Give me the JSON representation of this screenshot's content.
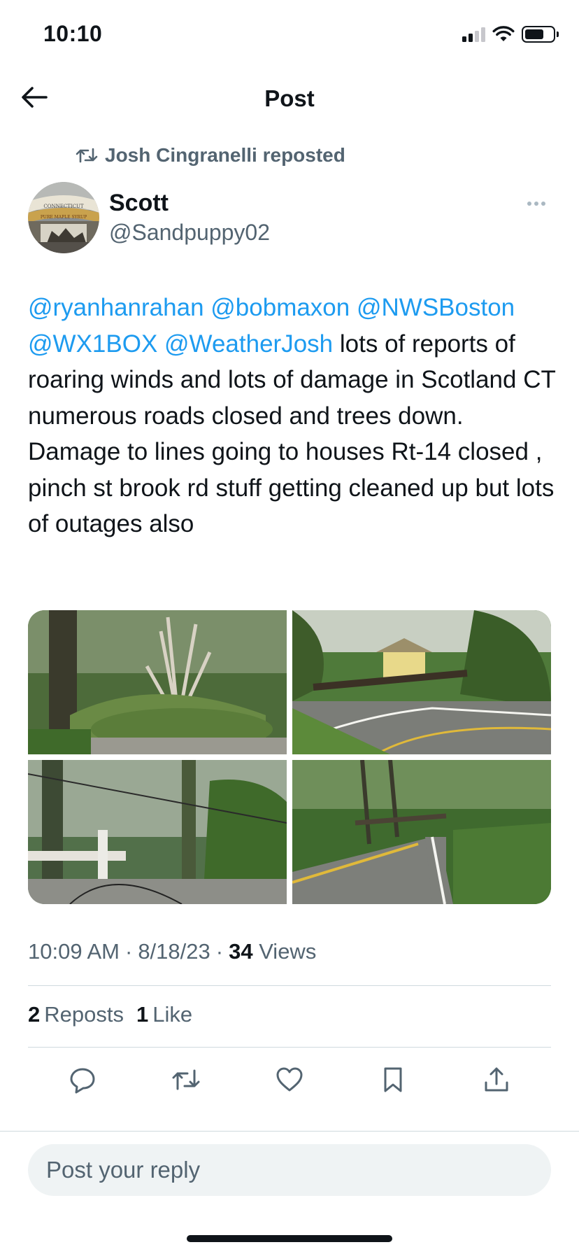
{
  "status_bar": {
    "time": "10:10"
  },
  "header": {
    "title": "Post"
  },
  "repost": {
    "text": "Josh Cingranelli reposted"
  },
  "author": {
    "name": "Scott",
    "handle": "@Sandpuppy02",
    "avatar_text_1": "CONNECTICUT",
    "avatar_text_2": "PURE MAPLE SYRUP"
  },
  "post": {
    "mentions": [
      "@ryanhanrahan",
      "@bobmaxon",
      "@NWSBoston",
      "@WX1BOX",
      "@WeatherJosh"
    ],
    "body": "lots of reports of roaring winds and lots of damage in Scotland CT numerous roads closed and trees down. Damage to lines going to houses Rt-14 closed , pinch st brook rd stuff getting cleaned up but lots of outages also",
    "media_count": 4
  },
  "meta": {
    "time": "10:09 AM",
    "date": "8/18/23",
    "views_count": "34",
    "views_label": "Views",
    "sep": "·"
  },
  "stats": {
    "reposts_count": "2",
    "reposts_label": "Reposts",
    "likes_count": "1",
    "likes_label": "Like"
  },
  "actions": [
    "reply",
    "repost",
    "like",
    "bookmark",
    "share"
  ],
  "reply": {
    "placeholder": "Post your reply"
  },
  "colors": {
    "link": "#1d9bf0",
    "secondary": "#536471",
    "text": "#0f1419",
    "divider": "#cfd9de",
    "input_bg": "#eff3f4"
  }
}
